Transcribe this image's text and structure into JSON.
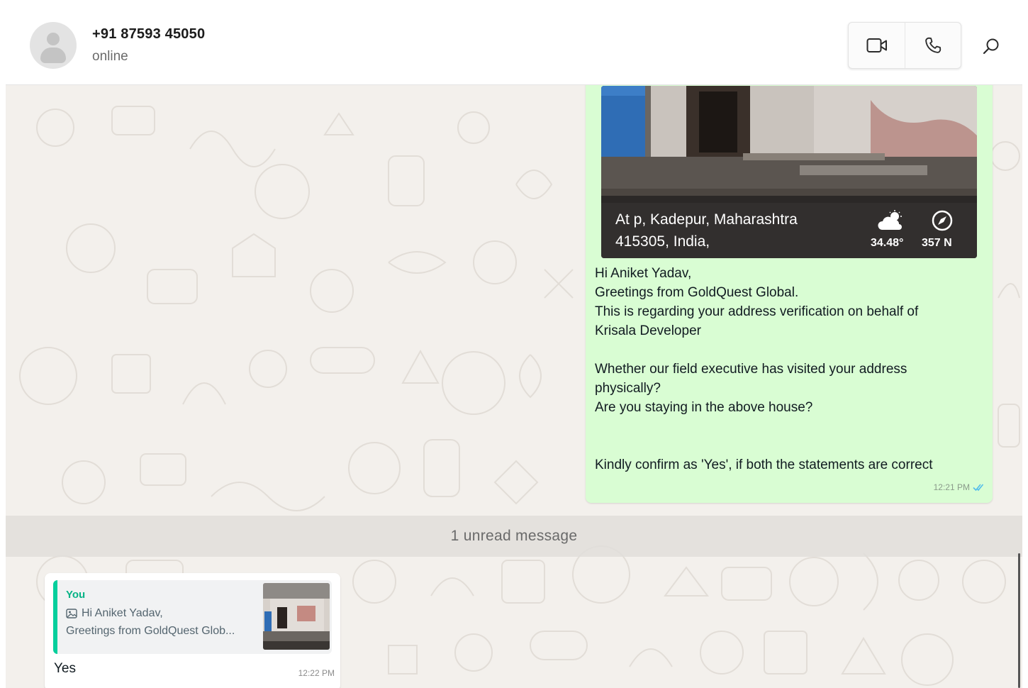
{
  "header": {
    "contact_name": "+91 87593 45050",
    "contact_status": "online",
    "icons": {
      "avatar": "default-avatar-icon",
      "video": "video-call-icon",
      "voice": "voice-call-icon",
      "search": "search-icon"
    }
  },
  "outgoing_message": {
    "photo": {
      "address_line1": "At p, Kadepur, Maharashtra",
      "address_line2": "415305, India,",
      "temperature": "34.48°",
      "direction": "357 N",
      "weather_icon": "partly-cloudy-icon",
      "compass_icon": "compass-icon"
    },
    "lines": [
      "Hi Aniket Yadav,",
      "Greetings from GoldQuest Global.",
      "This is regarding your address verification on behalf of",
      "Krisala Developer",
      "",
      "Whether our field executive has visited your address",
      "physically?",
      "Are you staying in the above house?",
      "",
      "",
      "Kindly confirm as 'Yes', if both the statements are correct"
    ],
    "time": "12:21 PM",
    "status_icon": "double-check-read-icon"
  },
  "unread_divider": {
    "text": "1 unread message"
  },
  "incoming_message": {
    "quote": {
      "author": "You",
      "line1": "Hi Aniket Yadav,",
      "line2": "Greetings from GoldQuest Glob...",
      "image_icon": "image-icon"
    },
    "text": "Yes",
    "time": "12:22 PM"
  },
  "colors": {
    "outgoing_bubble": "#d9fdd3",
    "quote_accent": "#06cf9c",
    "read_tick": "#53bdeb",
    "chat_background": "#f2efeb"
  }
}
